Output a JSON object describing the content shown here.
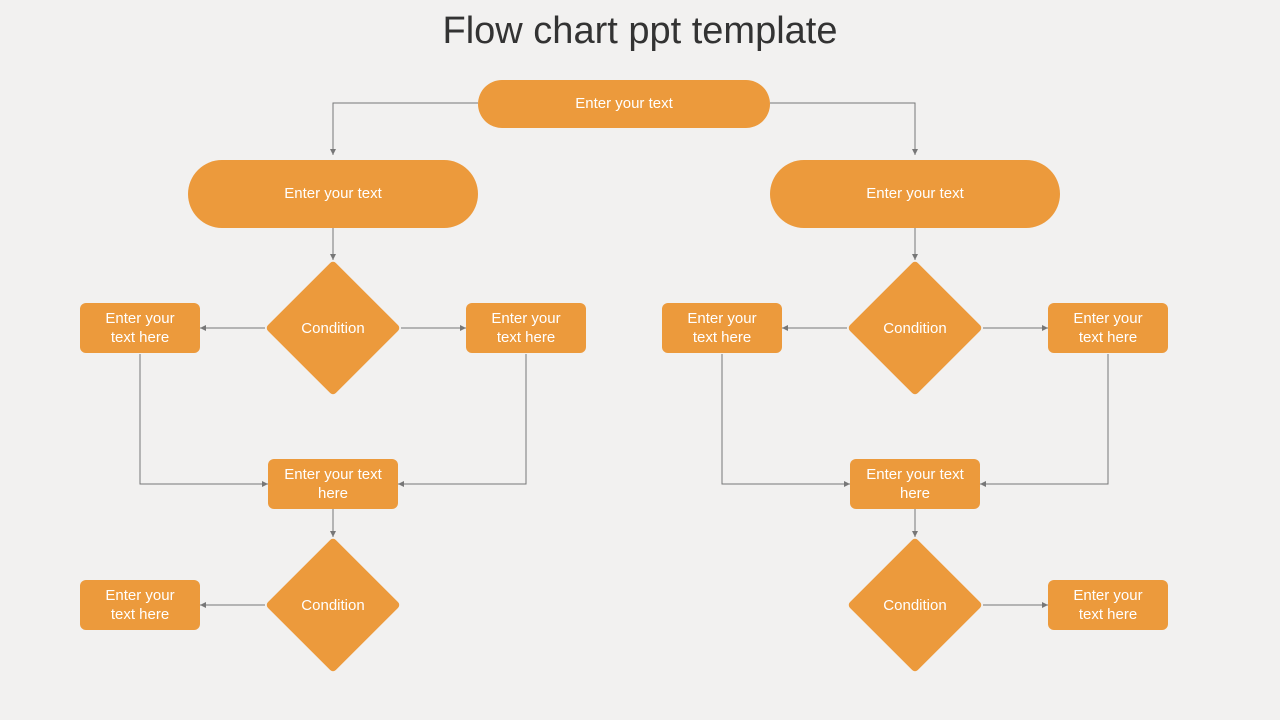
{
  "title": "Flow chart ppt template",
  "colors": {
    "accent": "#ec9a3c",
    "bg": "#f2f1f0",
    "text": "#333333"
  },
  "top": {
    "terminator": "Enter your text"
  },
  "left": {
    "terminator": "Enter your text",
    "decision1": "Condition",
    "sideLeft": "Enter your text here",
    "sideRight": "Enter your text here",
    "merge": "Enter your text here",
    "decision2": "Condition",
    "final": "Enter your text here"
  },
  "right": {
    "terminator": "Enter your text",
    "decision1": "Condition",
    "sideLeft": "Enter your text here",
    "sideRight": "Enter your text here",
    "merge": "Enter your text here",
    "decision2": "Condition",
    "final": "Enter your text here"
  },
  "chart_data": {
    "type": "flowchart",
    "title": "Flow chart ppt template",
    "nodes": [
      {
        "id": "start",
        "shape": "terminator",
        "label": "Enter your text"
      },
      {
        "id": "L_start",
        "shape": "terminator",
        "label": "Enter your text"
      },
      {
        "id": "R_start",
        "shape": "terminator",
        "label": "Enter your text"
      },
      {
        "id": "L_dec1",
        "shape": "decision",
        "label": "Condition"
      },
      {
        "id": "R_dec1",
        "shape": "decision",
        "label": "Condition"
      },
      {
        "id": "L_sl",
        "shape": "process",
        "label": "Enter your text here"
      },
      {
        "id": "L_sr",
        "shape": "process",
        "label": "Enter your text here"
      },
      {
        "id": "R_sl",
        "shape": "process",
        "label": "Enter your text here"
      },
      {
        "id": "R_sr",
        "shape": "process",
        "label": "Enter your text here"
      },
      {
        "id": "L_merge",
        "shape": "process",
        "label": "Enter your text here"
      },
      {
        "id": "R_merge",
        "shape": "process",
        "label": "Enter your text here"
      },
      {
        "id": "L_dec2",
        "shape": "decision",
        "label": "Condition"
      },
      {
        "id": "R_dec2",
        "shape": "decision",
        "label": "Condition"
      },
      {
        "id": "L_final",
        "shape": "process",
        "label": "Enter your text here"
      },
      {
        "id": "R_final",
        "shape": "process",
        "label": "Enter your text here"
      }
    ],
    "edges": [
      {
        "from": "start",
        "to": "L_start"
      },
      {
        "from": "start",
        "to": "R_start"
      },
      {
        "from": "L_start",
        "to": "L_dec1"
      },
      {
        "from": "R_start",
        "to": "R_dec1"
      },
      {
        "from": "L_dec1",
        "to": "L_sl"
      },
      {
        "from": "L_dec1",
        "to": "L_sr"
      },
      {
        "from": "R_dec1",
        "to": "R_sl"
      },
      {
        "from": "R_dec1",
        "to": "R_sr"
      },
      {
        "from": "L_sl",
        "to": "L_merge"
      },
      {
        "from": "L_sr",
        "to": "L_merge"
      },
      {
        "from": "R_sl",
        "to": "R_merge"
      },
      {
        "from": "R_sr",
        "to": "R_merge"
      },
      {
        "from": "L_merge",
        "to": "L_dec2"
      },
      {
        "from": "R_merge",
        "to": "R_dec2"
      },
      {
        "from": "L_dec2",
        "to": "L_final"
      },
      {
        "from": "R_dec2",
        "to": "R_final"
      }
    ]
  }
}
